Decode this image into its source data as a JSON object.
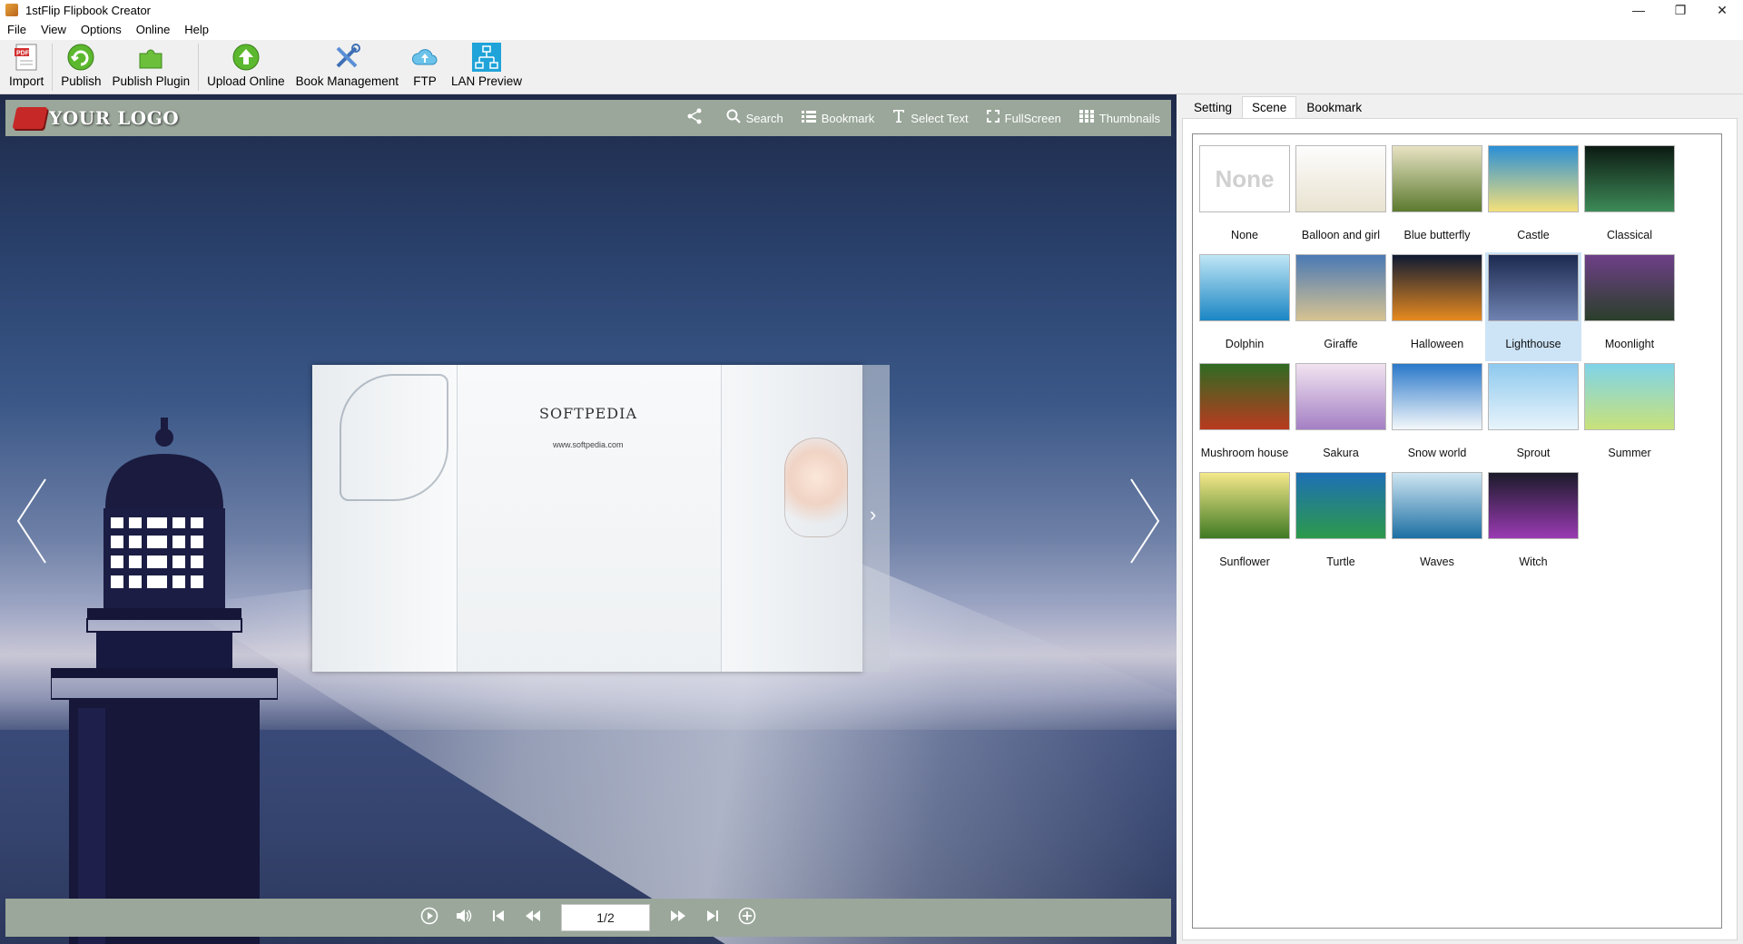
{
  "window": {
    "title": "1stFlip Flipbook Creator",
    "controls": [
      "—",
      "❐",
      "✕"
    ]
  },
  "menu": [
    "File",
    "View",
    "Options",
    "Online",
    "Help"
  ],
  "toolbar": {
    "buttons": [
      {
        "label": "Import",
        "icon": "import-pdf-icon"
      },
      {
        "label": "Publish",
        "icon": "publish-icon"
      },
      {
        "label": "Publish Plugin",
        "icon": "puzzle-plugin-icon"
      },
      {
        "label": "Upload Online",
        "icon": "upload-arrow-icon"
      },
      {
        "label": "Book Management",
        "icon": "tools-icon"
      },
      {
        "label": "FTP",
        "icon": "cloud-upload-icon"
      },
      {
        "label": "LAN Preview",
        "icon": "network-icon"
      }
    ]
  },
  "viewer": {
    "logo_text": "YOUR LOGO",
    "tools": [
      {
        "label": "",
        "icon": "share-icon"
      },
      {
        "label": "Search",
        "icon": "search-icon"
      },
      {
        "label": "Bookmark",
        "icon": "list-icon"
      },
      {
        "label": "Select Text",
        "icon": "text-icon"
      },
      {
        "label": "FullScreen",
        "icon": "fullscreen-icon"
      },
      {
        "label": "Thumbnails",
        "icon": "grid-icon"
      }
    ],
    "book": {
      "brand": "SOFTPEDIA",
      "url": "www.softpedia.com"
    },
    "page_indicator": "1/2",
    "controls": [
      "play-icon",
      "volume-icon",
      "first-page-icon",
      "prev-page-icon",
      "next-page-icon",
      "last-page-icon",
      "zoom-in-icon"
    ]
  },
  "panel": {
    "tabs": [
      "Setting",
      "Scene",
      "Bookmark"
    ],
    "active_tab": "Scene",
    "scenes": [
      {
        "name": "None",
        "colors": [
          "#ffffff",
          "#ffffff"
        ]
      },
      {
        "name": "Balloon and girl",
        "colors": [
          "#fdfdfd",
          "#e8e2d0"
        ]
      },
      {
        "name": "Blue butterfly",
        "colors": [
          "#e8e3c3",
          "#5c7a2f"
        ]
      },
      {
        "name": "Castle",
        "colors": [
          "#2a8fd6",
          "#f4e07a"
        ]
      },
      {
        "name": "Classical",
        "colors": [
          "#0c1a12",
          "#3d8a57"
        ]
      },
      {
        "name": "Dolphin",
        "colors": [
          "#bfe6f5",
          "#1a86c4"
        ]
      },
      {
        "name": "Giraffe",
        "colors": [
          "#4a79b5",
          "#d7c391"
        ]
      },
      {
        "name": "Halloween",
        "colors": [
          "#0e1a33",
          "#e78a1f"
        ]
      },
      {
        "name": "Lighthouse",
        "colors": [
          "#1c2a50",
          "#6f82b0"
        ]
      },
      {
        "name": "Moonlight",
        "colors": [
          "#6e3f88",
          "#2a3f2a"
        ]
      },
      {
        "name": "Mushroom house",
        "colors": [
          "#2f6b22",
          "#b93a1f"
        ]
      },
      {
        "name": "Sakura",
        "colors": [
          "#f1e3f0",
          "#a480c4"
        ]
      },
      {
        "name": "Snow world",
        "colors": [
          "#2a78c9",
          "#f4f8fb"
        ]
      },
      {
        "name": "Sprout",
        "colors": [
          "#8ec9ee",
          "#e8f4fb"
        ]
      },
      {
        "name": "Summer",
        "colors": [
          "#7fd3e8",
          "#c9e27a"
        ]
      },
      {
        "name": "Sunflower",
        "colors": [
          "#f5e88a",
          "#3f7a23"
        ]
      },
      {
        "name": "Turtle",
        "colors": [
          "#1e6fb5",
          "#2c9a4a"
        ]
      },
      {
        "name": "Waves",
        "colors": [
          "#cfe6f2",
          "#1c6fa3"
        ]
      },
      {
        "name": "Witch",
        "colors": [
          "#1b1b2a",
          "#9a3ab3"
        ]
      }
    ],
    "selected_scene": "Lighthouse"
  }
}
